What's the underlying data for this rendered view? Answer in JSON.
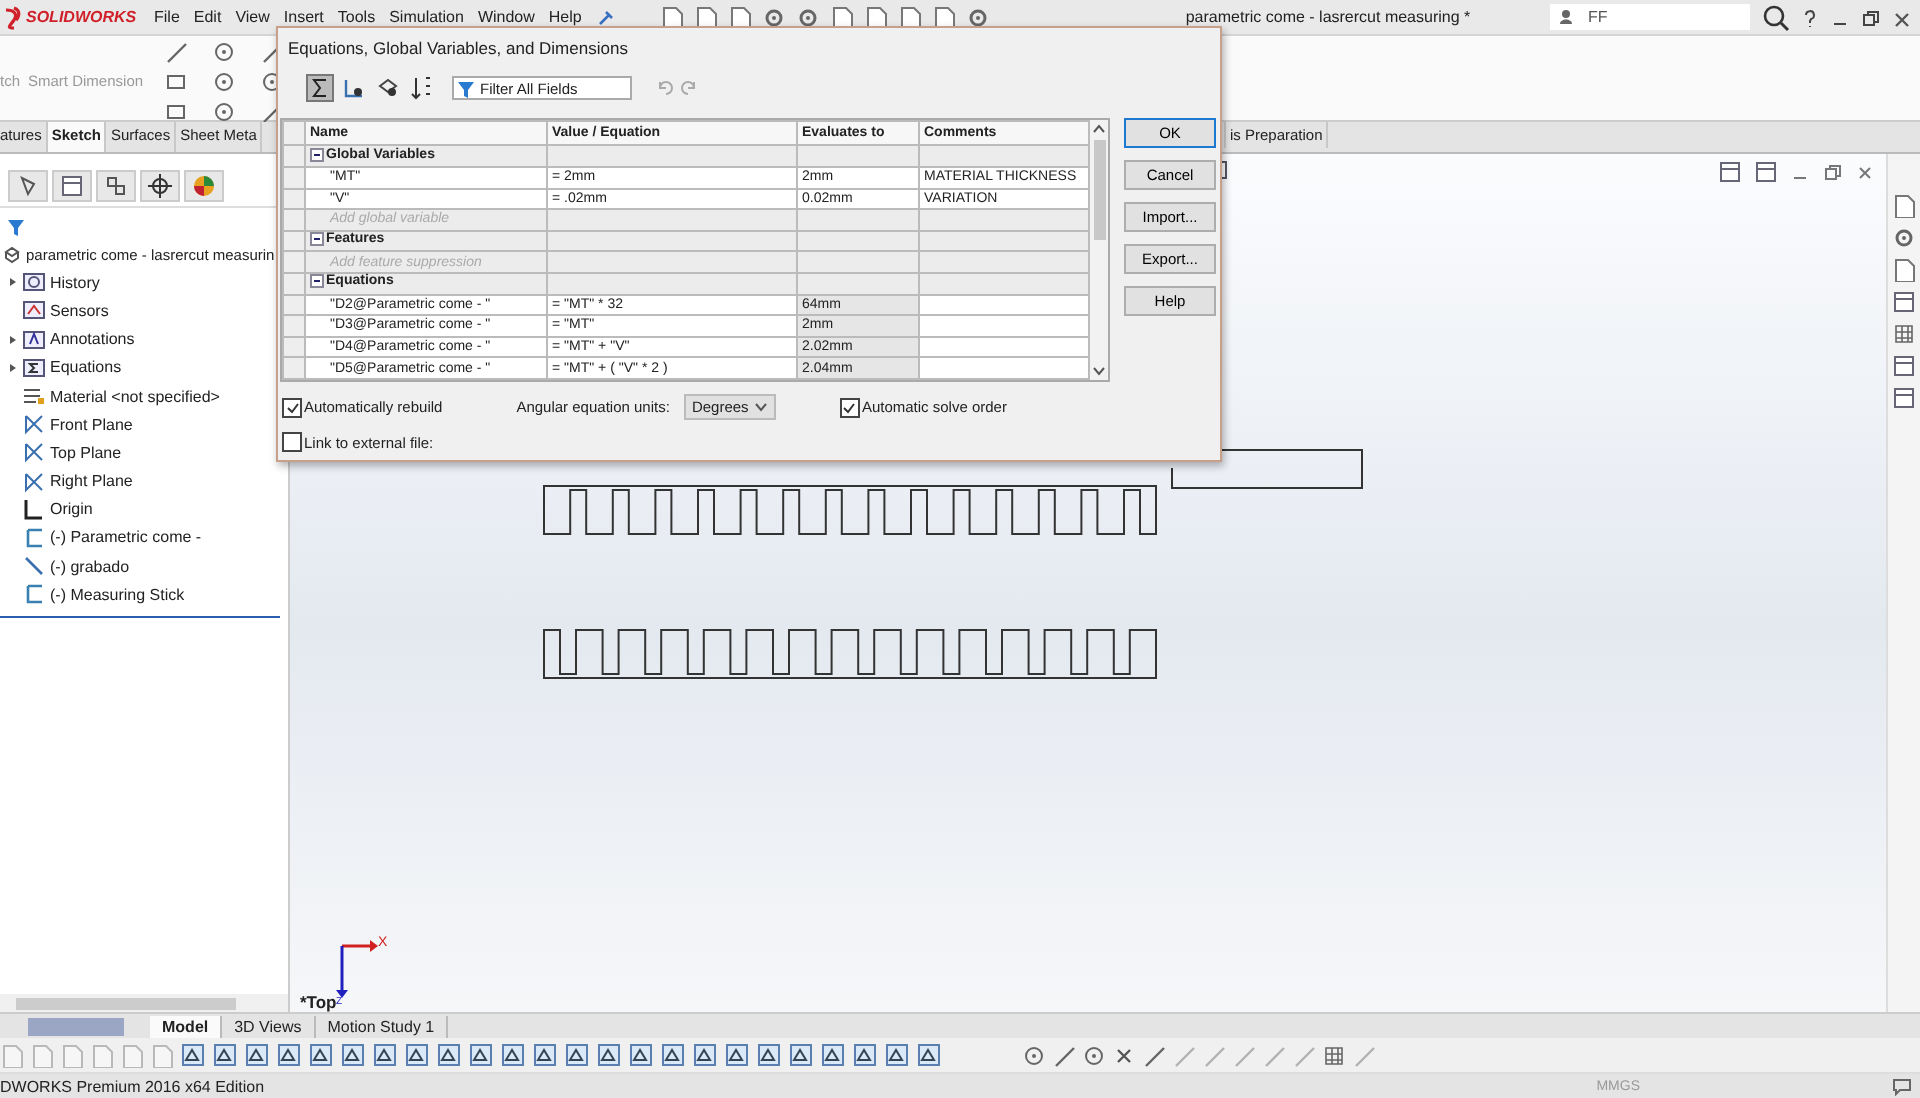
{
  "app": {
    "logo": "SOLIDWORKS",
    "menu": [
      "File",
      "Edit",
      "View",
      "Insert",
      "Tools",
      "Simulation",
      "Window",
      "Help"
    ],
    "title": "parametric come - lasrercut measuring *",
    "search": {
      "value": "FF"
    }
  },
  "command_manager": {
    "buttons": [
      "tch",
      "Smart Dimension"
    ]
  },
  "tabs": [
    {
      "label": "atures",
      "selected": false
    },
    {
      "label": "Sketch",
      "selected": true
    },
    {
      "label": "Surfaces",
      "selected": false
    },
    {
      "label": "Sheet Meta",
      "selected": false
    },
    {
      "label": "is Preparation",
      "selected": false
    }
  ],
  "feature_tree": {
    "root": "parametric come - lasrercut measurin",
    "items": [
      {
        "label": "History",
        "kind": "history",
        "expandable": true
      },
      {
        "label": "Sensors",
        "kind": "sensors",
        "expandable": false
      },
      {
        "label": "Annotations",
        "kind": "annotations",
        "expandable": true
      },
      {
        "label": "Equations",
        "kind": "equations",
        "expandable": true
      },
      {
        "label": "Material <not specified>",
        "kind": "material",
        "expandable": false
      },
      {
        "label": "Front Plane",
        "kind": "plane",
        "expandable": false
      },
      {
        "label": "Top Plane",
        "kind": "plane",
        "expandable": false
      },
      {
        "label": "Right Plane",
        "kind": "plane",
        "expandable": false
      },
      {
        "label": "Origin",
        "kind": "origin",
        "expandable": false
      },
      {
        "label": "(-) Parametric come -",
        "kind": "sketch",
        "expandable": false
      },
      {
        "label": "(-) grabado",
        "kind": "line-sketch",
        "expandable": false
      },
      {
        "label": "(-) Measuring Stick",
        "kind": "sketch",
        "expandable": false
      }
    ]
  },
  "view": {
    "name": "*Top",
    "triad": {
      "x": "X",
      "z": "Z"
    }
  },
  "bottom_tabs": [
    {
      "label": "Model",
      "selected": true
    },
    {
      "label": "3D Views",
      "selected": false
    },
    {
      "label": "Motion Study 1",
      "selected": false
    }
  ],
  "status_bar": {
    "edition": "DWORKS Premium 2016 x64 Edition",
    "units": "MMGS"
  },
  "dialog": {
    "title": "Equations, Global Variables, and Dimensions",
    "filter": {
      "placeholder": "Filter All Fields"
    },
    "columns": [
      "Name",
      "Value / Equation",
      "Evaluates to",
      "Comments"
    ],
    "rows": [
      {
        "kind": "group",
        "name": "Global Variables"
      },
      {
        "kind": "item",
        "name": "\"MT\"",
        "value": "= 2mm",
        "evaluates": "2mm",
        "comment": "MATERIAL THICKNESS"
      },
      {
        "kind": "item",
        "name": "\"V\"",
        "value": "= .02mm",
        "evaluates": "0.02mm",
        "comment": "VARIATION"
      },
      {
        "kind": "add",
        "name": "Add global variable"
      },
      {
        "kind": "group",
        "name": "Features"
      },
      {
        "kind": "add",
        "name": "Add feature suppression"
      },
      {
        "kind": "group",
        "name": "Equations"
      },
      {
        "kind": "equation",
        "name": "\"D2@Parametric come - \"",
        "value": "= \"MT\" * 32",
        "evaluates": "64mm"
      },
      {
        "kind": "equation",
        "name": "\"D3@Parametric come - \"",
        "value": "= \"MT\"",
        "evaluates": "2mm"
      },
      {
        "kind": "equation",
        "name": "\"D4@Parametric come - \"",
        "value": "= \"MT\" + \"V\"",
        "evaluates": "2.02mm"
      },
      {
        "kind": "equation",
        "name": "\"D5@Parametric come - \"",
        "value": "= \"MT\" + ( \"V\" * 2 )",
        "evaluates": "2.04mm"
      }
    ],
    "buttons": [
      {
        "label": "OK",
        "default": true
      },
      {
        "label": "Cancel",
        "default": false
      },
      {
        "label": "Import...",
        "default": false
      },
      {
        "label": "Export...",
        "default": false
      },
      {
        "label": "Help",
        "default": false
      }
    ],
    "auto_rebuild": {
      "label": "Automatically rebuild",
      "checked": true
    },
    "angular_units": {
      "label": "Angular equation units:",
      "value": "Degrees"
    },
    "auto_solve": {
      "label": "Automatic solve order",
      "checked": true
    },
    "link_external": {
      "label": "Link to external file:",
      "checked": false
    }
  }
}
